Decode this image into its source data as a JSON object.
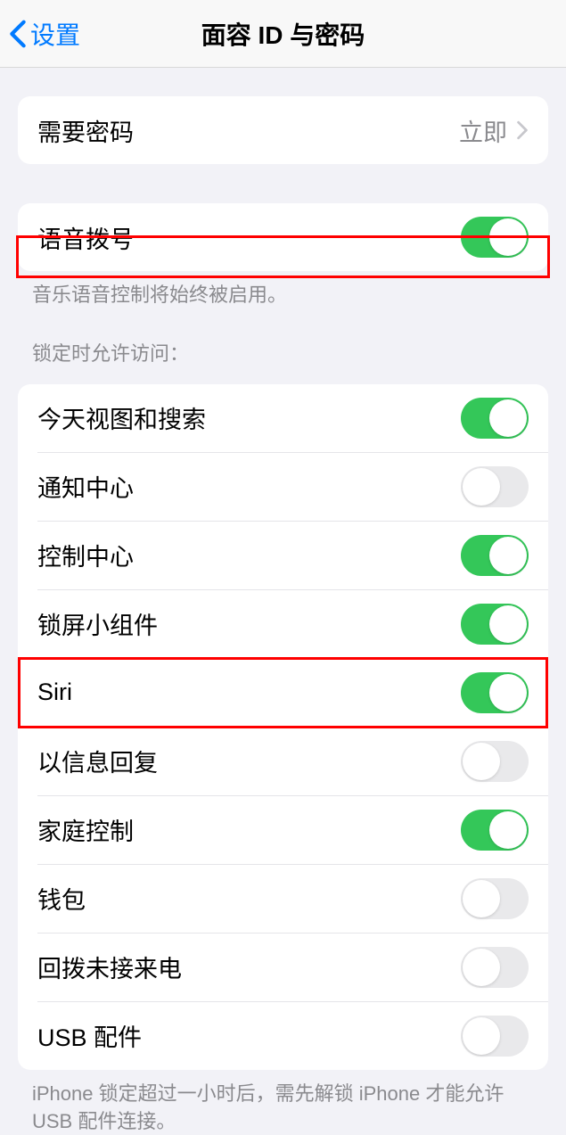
{
  "nav": {
    "back_label": "设置",
    "title": "面容 ID 与密码"
  },
  "passcode_section": {
    "require_passcode_label": "需要密码",
    "require_passcode_value": "立即"
  },
  "voice_dial": {
    "label": "语音拨号",
    "on": true,
    "footer": "音乐语音控制将始终被启用。"
  },
  "lock_access": {
    "header": "锁定时允许访问：",
    "items": [
      {
        "key": "today",
        "label": "今天视图和搜索",
        "on": true
      },
      {
        "key": "notification",
        "label": "通知中心",
        "on": false
      },
      {
        "key": "control",
        "label": "控制中心",
        "on": true
      },
      {
        "key": "widgets",
        "label": "锁屏小组件",
        "on": true
      },
      {
        "key": "siri",
        "label": "Siri",
        "on": true
      },
      {
        "key": "reply",
        "label": "以信息回复",
        "on": false
      },
      {
        "key": "home",
        "label": "家庭控制",
        "on": true
      },
      {
        "key": "wallet",
        "label": "钱包",
        "on": false
      },
      {
        "key": "callback",
        "label": "回拨未接来电",
        "on": false
      },
      {
        "key": "usb",
        "label": "USB 配件",
        "on": false
      }
    ],
    "footer": "iPhone 锁定超过一小时后，需先解锁 iPhone 才能允许 USB 配件连接。"
  }
}
